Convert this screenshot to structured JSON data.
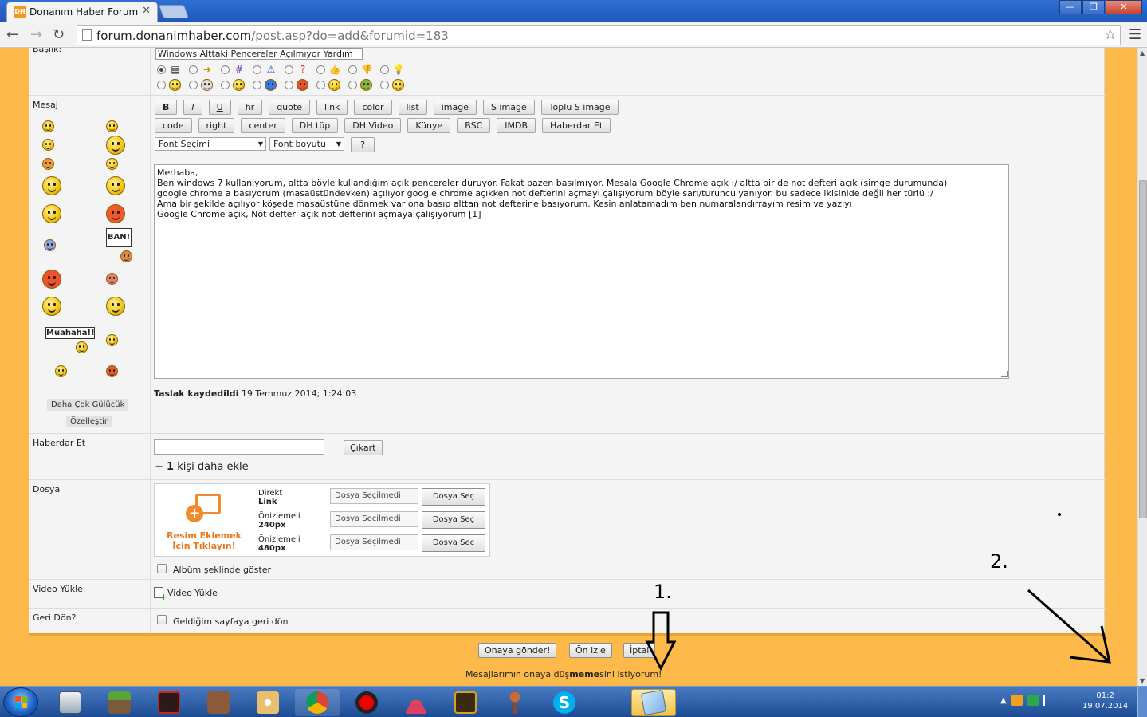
{
  "browser": {
    "tab_title": "Donanım Haber Forum",
    "tab_favicon": "DH",
    "url_host": "forum.donanimhaber.com",
    "url_path": "/post.asp?do=add&forumid=183"
  },
  "form": {
    "title_label": "Başlık:",
    "title_value": "Windows Alttaki Pencereler Açılmıyor Yardım",
    "message_label": "Mesaj",
    "bbcode_row1": [
      "B",
      "I",
      "U",
      "hr",
      "quote",
      "link",
      "color",
      "list",
      "image",
      "S image",
      "Toplu S image"
    ],
    "bbcode_row2": [
      "code",
      "right",
      "center",
      "DH tüp",
      "DH Video",
      "Künye",
      "BSC",
      "IMDB",
      "Haberdar Et"
    ],
    "font_select": "Font Seçimi",
    "font_size_select": "Font boyutu",
    "help_button": "?",
    "banner_sign": "BAN!",
    "muahaha_sign": "Muahaha!!",
    "more_smileys": "Daha Çok Gülücük",
    "customize": "Özelleştir",
    "message_lines": [
      "Merhaba,",
      "Ben windows 7 kullanıyorum, altta böyle kullandığım açık pencereler duruyor. Fakat bazen basılmıyor. Mesala Google Chrome açık :/ altta bir de not defteri açık (simge durumunda)",
      "google chrome a basıyorum (masaüstündevken) açılıyor google chrome açıkken not defterini açmayı çalışıyorum böyle sarı/turuncu yanıyor. bu sadece ikisinide değil her türlü :/",
      "Ama bir şekilde açılıyor köşede masaüstüne dönmek var ona basıp alttan not defterine basıyorum. Kesin anlatamadım ben numaralandırrayım resim ve yazıyı",
      "",
      "",
      "Google Chrome açık, Not defteri açık not defterini açmaya çalışıyorum [1]"
    ],
    "draft_bold": "Taslak kaydedildi",
    "draft_time": "19 Temmuz 2014; 1:24:03",
    "notify_label": "Haberdar Et",
    "notify_remove": "Çıkart",
    "notify_add_prefix": "+",
    "notify_add_count": "1",
    "notify_add_suffix": "kişi daha ekle",
    "file_label": "Dosya",
    "upload_title": "Resim Eklemek İçin Tıklayın!",
    "upload_rows": [
      {
        "label_top": "Direkt",
        "label_bottom": "Link",
        "field": "Dosya Seçilmedi",
        "button": "Dosya Seç"
      },
      {
        "label_top": "Önizlemeli",
        "label_bottom": "240px",
        "field": "Dosya Seçilmedi",
        "button": "Dosya Seç"
      },
      {
        "label_top": "Önizlemeli",
        "label_bottom": "480px",
        "field": "Dosya Seçilmedi",
        "button": "Dosya Seç"
      }
    ],
    "album_label": "Albüm şeklinde göster",
    "video_label": "Video Yükle",
    "video_link": "Video Yükle",
    "back_label": "Geri Dön?",
    "back_checkbox": "Geldiğim sayfaya geri dön",
    "submit": "Onaya gönder!",
    "preview": "Ön izle",
    "cancel": "İptal",
    "notice_pre": "Mesajlarımın onaya düş",
    "notice_bold": "meme",
    "notice_post": "sini istiyorum!"
  },
  "annotations": {
    "label_1": "1.",
    "label_2": "2."
  },
  "taskbar": {
    "clock_time": "01:2",
    "clock_date": "19.07.2014"
  },
  "colors": {
    "page_bg": "#fdb94a",
    "form_bg": "#f4f4f4",
    "upload_orange": "#e8781f",
    "taskbar": "#1c4b93"
  }
}
